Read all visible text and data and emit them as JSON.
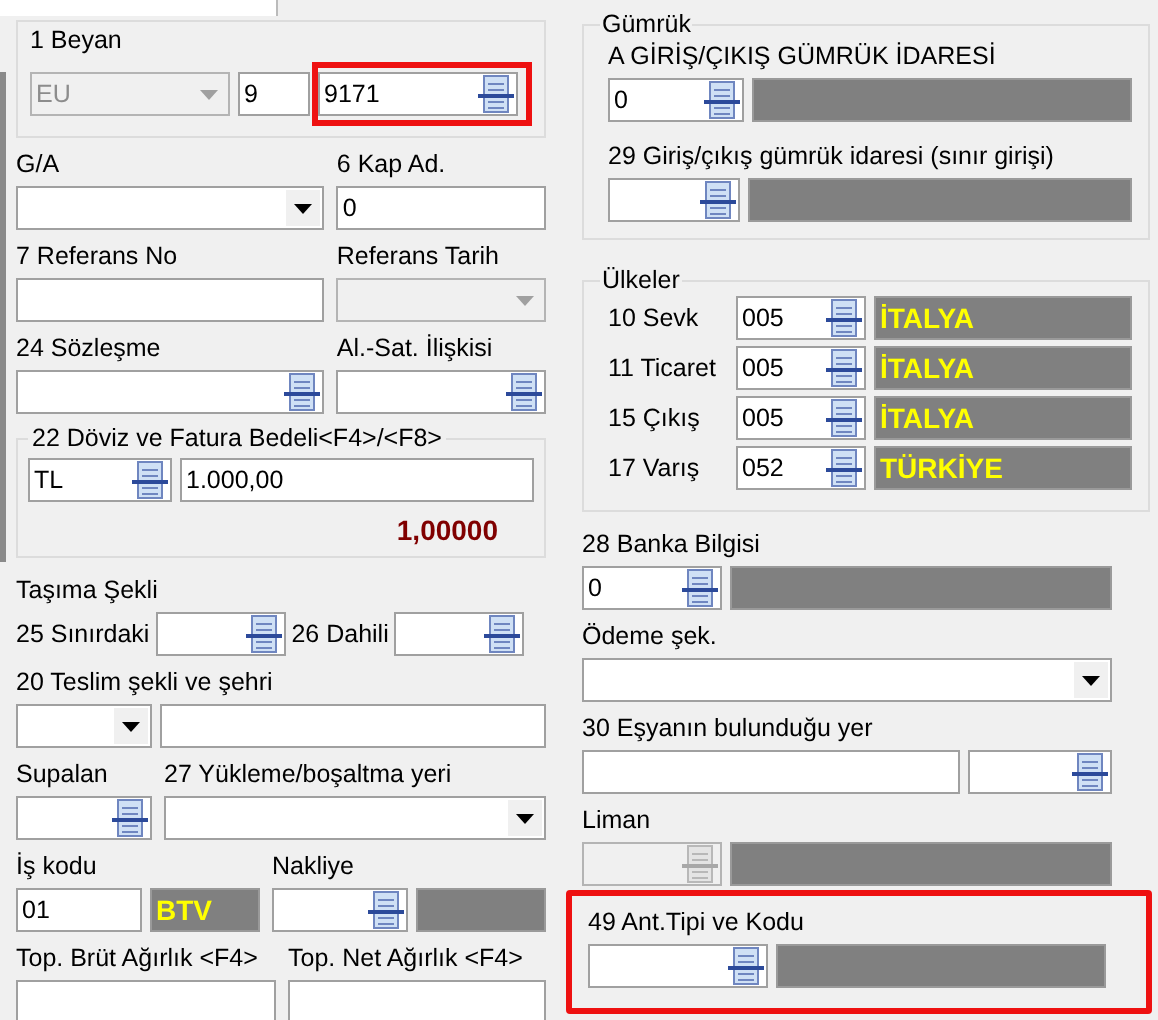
{
  "beyan": {
    "title": "1 Beyan",
    "type": {
      "value": "EU",
      "disabled": true
    },
    "number": {
      "value": "9"
    },
    "code": {
      "value": "9171",
      "highlighted": true
    }
  },
  "ga": {
    "label": "G/A"
  },
  "kap": {
    "label": "6 Kap Ad.",
    "value": "0"
  },
  "ref_no": {
    "label": "7 Referans No"
  },
  "ref_date": {
    "label": "Referans Tarih",
    "disabled": true
  },
  "contract": {
    "label": "24 Sözleşme"
  },
  "relation": {
    "label": "Al.-Sat. İlişkisi"
  },
  "invoice": {
    "title": "22 Döviz ve Fatura Bedeli<F4>/<F8>",
    "currency": "TL",
    "amount": "1.000,00",
    "rate": "1,00000"
  },
  "transport": {
    "title": "Taşıma Şekli",
    "border_label": "25 Sınırdaki",
    "inland_label": "26 Dahili"
  },
  "delivery": {
    "label": "20 Teslim şekli ve şehri"
  },
  "supalan": {
    "label": "Supalan"
  },
  "loading": {
    "label": "27 Yükleme/boşaltma yeri"
  },
  "job": {
    "label": "İş kodu",
    "value": "01",
    "name": "BTV"
  },
  "freight": {
    "label": "Nakliye"
  },
  "gross": {
    "label": "Top. Brüt Ağırlık <F4>"
  },
  "net": {
    "label": "Top. Net Ağırlık <F4>"
  },
  "customs": {
    "title": "Gümrük",
    "office_label": "A GİRİŞ/ÇIKIŞ GÜMRÜK İDARESİ",
    "office_code": "0",
    "border_label": "29 Giriş/çıkış gümrük idaresi (sınır girişi)"
  },
  "countries": {
    "title": "Ülkeler",
    "rows": [
      {
        "label": "10 Sevk",
        "code": "005",
        "name": "İTALYA"
      },
      {
        "label": "11 Ticaret",
        "code": "005",
        "name": "İTALYA"
      },
      {
        "label": "15 Çıkış",
        "code": "005",
        "name": "İTALYA"
      },
      {
        "label": "17 Varış",
        "code": "052",
        "name": "TÜRKİYE"
      }
    ]
  },
  "bank": {
    "label": "28 Banka Bilgisi",
    "code": "0"
  },
  "payment": {
    "label": "Ödeme şek."
  },
  "location": {
    "label": "30 Eşyanın bulunduğu yer"
  },
  "port": {
    "label": "Liman",
    "disabled": true
  },
  "ant": {
    "label": "49 Ant.Tipi ve Kodu",
    "highlighted": true
  }
}
